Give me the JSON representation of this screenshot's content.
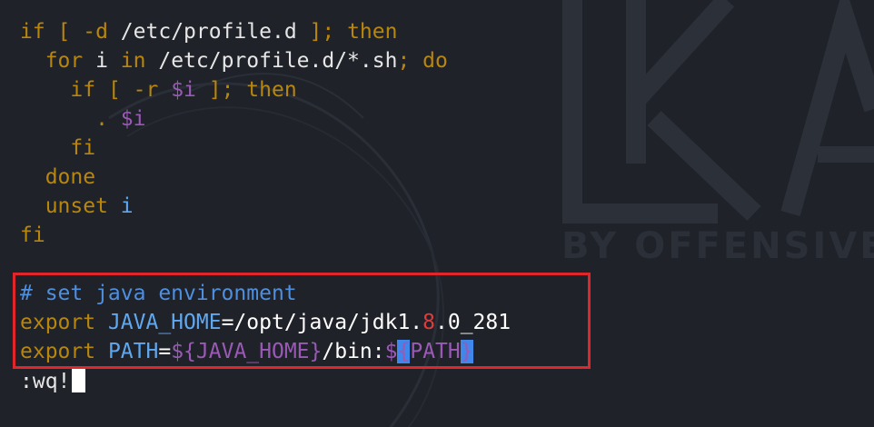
{
  "watermark": {
    "tagline": "BY OFFENSIVE"
  },
  "code_lines": [
    [
      {
        "t": "if",
        "c": "kw"
      },
      {
        "t": " [ ",
        "c": "kw"
      },
      {
        "t": "-d",
        "c": "kw"
      },
      {
        "t": " /etc/profile.d ",
        "c": "plain"
      },
      {
        "t": "];",
        "c": "kw"
      },
      {
        "t": " then",
        "c": "kw"
      }
    ],
    [
      {
        "t": "  for",
        "c": "kw"
      },
      {
        "t": " i ",
        "c": "plain"
      },
      {
        "t": "in",
        "c": "kw"
      },
      {
        "t": " /etc/profile.d/*.sh",
        "c": "plain"
      },
      {
        "t": "; do",
        "c": "kw"
      }
    ],
    [
      {
        "t": "    if",
        "c": "kw"
      },
      {
        "t": " [ ",
        "c": "kw"
      },
      {
        "t": "-r",
        "c": "kw"
      },
      {
        "t": " ",
        "c": "plain"
      },
      {
        "t": "$i",
        "c": "var"
      },
      {
        "t": " ];",
        "c": "kw"
      },
      {
        "t": " then",
        "c": "kw"
      }
    ],
    [
      {
        "t": "      . ",
        "c": "kw"
      },
      {
        "t": "$i",
        "c": "var"
      }
    ],
    [
      {
        "t": "    fi",
        "c": "kw"
      }
    ],
    [
      {
        "t": "  done",
        "c": "kw"
      }
    ],
    [
      {
        "t": "  unset",
        "c": "kw"
      },
      {
        "t": " i",
        "c": "ident"
      }
    ],
    [
      {
        "t": "fi",
        "c": "kw"
      }
    ],
    [
      {
        "t": "",
        "c": "plain"
      }
    ],
    [
      {
        "t": "# set java environment",
        "c": "comment"
      }
    ],
    [
      {
        "t": "export",
        "c": "exp"
      },
      {
        "t": " JAVA_HOME",
        "c": "ident"
      },
      {
        "t": "=/opt/java/jdk1.",
        "c": "path"
      },
      {
        "t": "8",
        "c": "num"
      },
      {
        "t": ".0_281",
        "c": "path"
      }
    ],
    [
      {
        "t": "export",
        "c": "exp"
      },
      {
        "t": " PATH",
        "c": "ident"
      },
      {
        "t": "=",
        "c": "path"
      },
      {
        "t": "${JAVA_HOME}",
        "c": "var"
      },
      {
        "t": "/bin:",
        "c": "path"
      },
      {
        "t": "$",
        "c": "var"
      },
      {
        "t": "{",
        "c": "bracket-hl"
      },
      {
        "t": "PATH",
        "c": "var"
      },
      {
        "t": "}",
        "c": "bracket-hl"
      }
    ]
  ],
  "command_line": {
    "text": ":wq!"
  },
  "colors": {
    "background": "#1f2229",
    "keyword": "#b8860b",
    "variable": "#9b59b6",
    "comment": "#4e8fe0",
    "identifier": "#5fa8f0",
    "number": "#e03c3c",
    "highlight_border": "#e0262a",
    "bracket_match": "#3f87ea"
  }
}
